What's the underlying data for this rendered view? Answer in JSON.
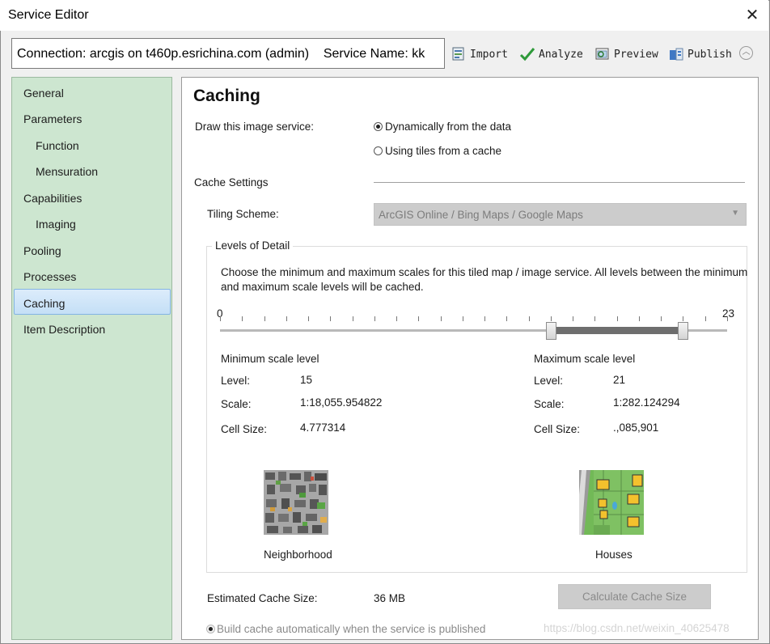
{
  "window": {
    "title": "Service Editor",
    "close_glyph": "✕"
  },
  "connection": {
    "text": "Connection: arcgis on t460p.esrichina.com (admin)    Service Name: kk"
  },
  "toolbar": {
    "import_label": "Import",
    "analyze_label": "Analyze",
    "preview_label": "Preview",
    "publish_label": "Publish",
    "collapse_glyph": "︿"
  },
  "sidebar": {
    "items": [
      {
        "label": "General",
        "level": "top"
      },
      {
        "label": "Parameters",
        "level": "top"
      },
      {
        "label": "Function",
        "level": "sub"
      },
      {
        "label": "Mensuration",
        "level": "sub"
      },
      {
        "label": "Capabilities",
        "level": "top"
      },
      {
        "label": "Imaging",
        "level": "sub"
      },
      {
        "label": "Pooling",
        "level": "top"
      },
      {
        "label": "Processes",
        "level": "top"
      },
      {
        "label": "Caching",
        "level": "top",
        "selected": true
      },
      {
        "label": "Item Description",
        "level": "top"
      }
    ]
  },
  "caching": {
    "title": "Caching",
    "draw_label": "Draw this image service:",
    "option_dynamic": "Dynamically from the data",
    "option_tiles": "Using tiles from a cache",
    "selected_option": "dynamic",
    "cache_settings_label": "Cache Settings",
    "tiling_label": "Tiling Scheme:",
    "tiling_value": "ArcGIS Online / Bing Maps / Google Maps",
    "lod_legend": "Levels of Detail",
    "lod_desc_line1": "Choose the minimum and maximum scales for this tiled map / image service. All levels between the minimum",
    "lod_desc_line2": "and maximum scale levels will be cached.",
    "slider": {
      "min": "0",
      "max": "23",
      "low": 15,
      "high": 21,
      "range_max": 23
    },
    "min_scale": {
      "heading": "Minimum scale level",
      "level_label": "Level:",
      "level_value": "15",
      "scale_label": "Scale:",
      "scale_value": "1:18,055.954822",
      "cell_label": "Cell Size:",
      "cell_value": "4.777314",
      "preview_caption": "Neighborhood"
    },
    "max_scale": {
      "heading": "Maximum scale level",
      "level_label": "Level:",
      "level_value": "21",
      "scale_label": "Scale:",
      "scale_value": "1:282.124294",
      "cell_label": "Cell Size:",
      "cell_value": ".,085,901",
      "preview_caption": "Houses"
    },
    "estimated_label": "Estimated Cache Size:",
    "estimated_value": "36 MB",
    "calc_button": "Calculate Cache Size",
    "build_label": "Build cache automatically when the service is published"
  },
  "watermark": "https://blog.csdn.net/weixin_40625478",
  "colors": {
    "sidebar_bg": "#cde6d0",
    "selected_bg": "#c4dff6",
    "analyze_check": "#2e9a3a"
  }
}
